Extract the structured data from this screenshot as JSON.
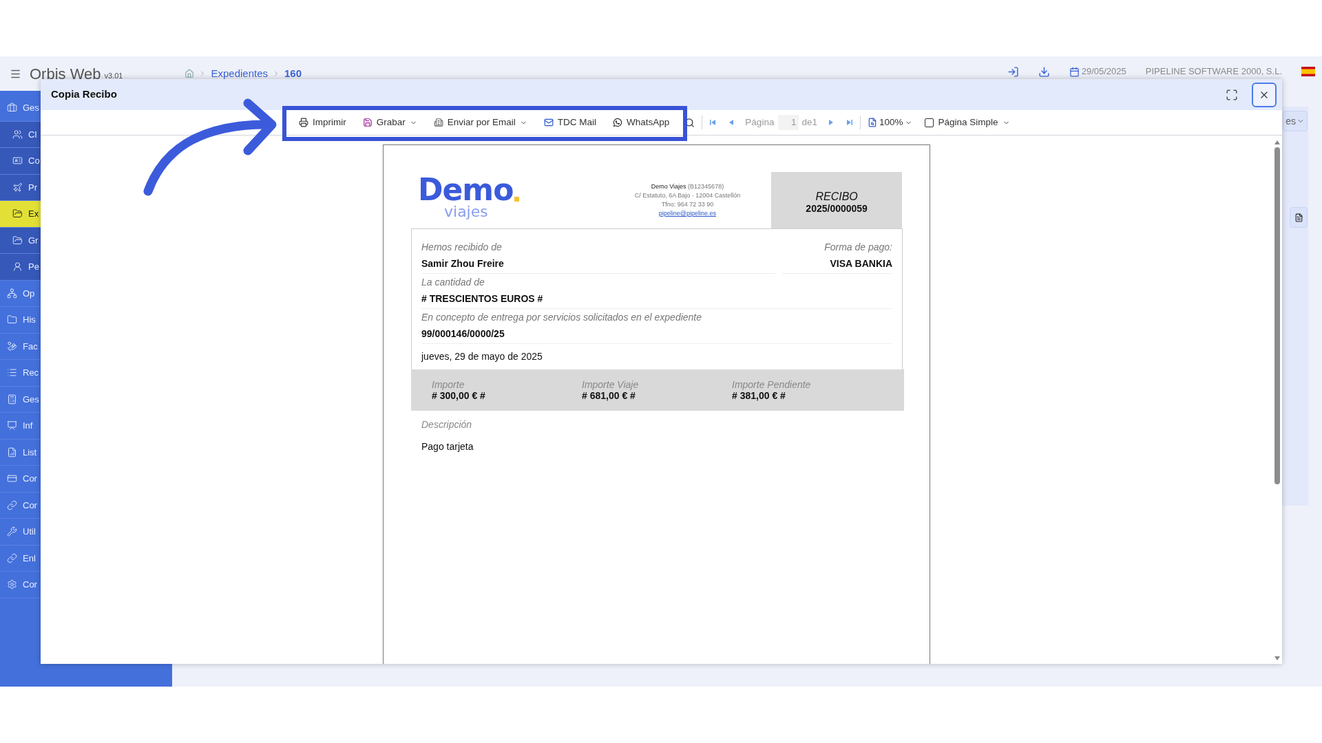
{
  "header": {
    "app_name": "Orbis Web",
    "version": "v3.01",
    "breadcrumb": [
      "Expedientes",
      "160"
    ],
    "date": "29/05/2025",
    "company": "PIPELINE SOFTWARE 2000, S.L."
  },
  "sidebar": {
    "items": [
      {
        "label": "Ges",
        "selected": false,
        "children": [
          {
            "label": "Cl",
            "selected": false
          },
          {
            "label": "Co",
            "selected": false
          },
          {
            "label": "Pr",
            "selected": false
          },
          {
            "label": "Ex",
            "selected": true
          },
          {
            "label": "Gr",
            "selected": false
          },
          {
            "label": "Pe",
            "selected": false
          }
        ]
      },
      {
        "label": "Op",
        "selected": false
      },
      {
        "label": "His",
        "selected": false
      },
      {
        "label": "Fac",
        "selected": false
      },
      {
        "label": "Rec",
        "selected": false
      },
      {
        "label": "Ges",
        "selected": false
      },
      {
        "label": "Inf",
        "selected": false
      },
      {
        "label": "List",
        "selected": false
      },
      {
        "label": "Cor",
        "selected": false
      },
      {
        "label": "Cor",
        "selected": false
      },
      {
        "label": "Util",
        "selected": false
      },
      {
        "label": "Enl",
        "selected": false
      },
      {
        "label": "Cor",
        "selected": false
      }
    ]
  },
  "background_panel": {
    "button": "es"
  },
  "dialog": {
    "title": "Copia Recibo",
    "toolbar": {
      "actions": [
        {
          "label": "Imprimir",
          "kind": "print",
          "dropdown": false
        },
        {
          "label": "Grabar",
          "kind": "save",
          "dropdown": true
        },
        {
          "label": "Enviar por Email",
          "kind": "email",
          "dropdown": true
        },
        {
          "label": "TDC Mail",
          "kind": "tdc",
          "dropdown": false
        },
        {
          "label": "WhatsApp",
          "kind": "chat",
          "dropdown": false
        }
      ],
      "page_label": "Página",
      "page": "1",
      "page_of": "de1",
      "zoom": "100%",
      "single_page": {
        "label": "Página Simple",
        "checked": false
      }
    },
    "document": {
      "logo": {
        "word": "Demo",
        "sub": "viajes"
      },
      "company": "Demo Viajes",
      "company_id": "(B12345678)",
      "address": "C/ Estatuto, 6A Bajo · 12004 Castellón",
      "phone": "Tfno: 964 72 33 90",
      "email": "pipeline@pipeline.es",
      "title": "RECIBO",
      "number": "2025/0000059",
      "received_label": "Hemos recibido de",
      "received_from": "Samir Zhou Freire",
      "payment_label": "Forma de pago:",
      "payment": "VISA BANKIA",
      "amount_label": "La cantidad de",
      "amount_words": "# TRESCIENTOS EUROS #",
      "concept_label": "En concepto de entrega por servicios solicitados en el expediente",
      "file": "99/000146/0000/25",
      "date": "jueves, 29 de mayo de 2025",
      "totals": [
        {
          "label": "Importe",
          "value": "# 300,00 € #"
        },
        {
          "label": "Importe Viaje",
          "value": "# 681,00 € #"
        },
        {
          "label": "Importe Pendiente",
          "value": "# 381,00 € #"
        }
      ],
      "description_label": "Descripción",
      "description": "Pago tarjeta"
    }
  }
}
